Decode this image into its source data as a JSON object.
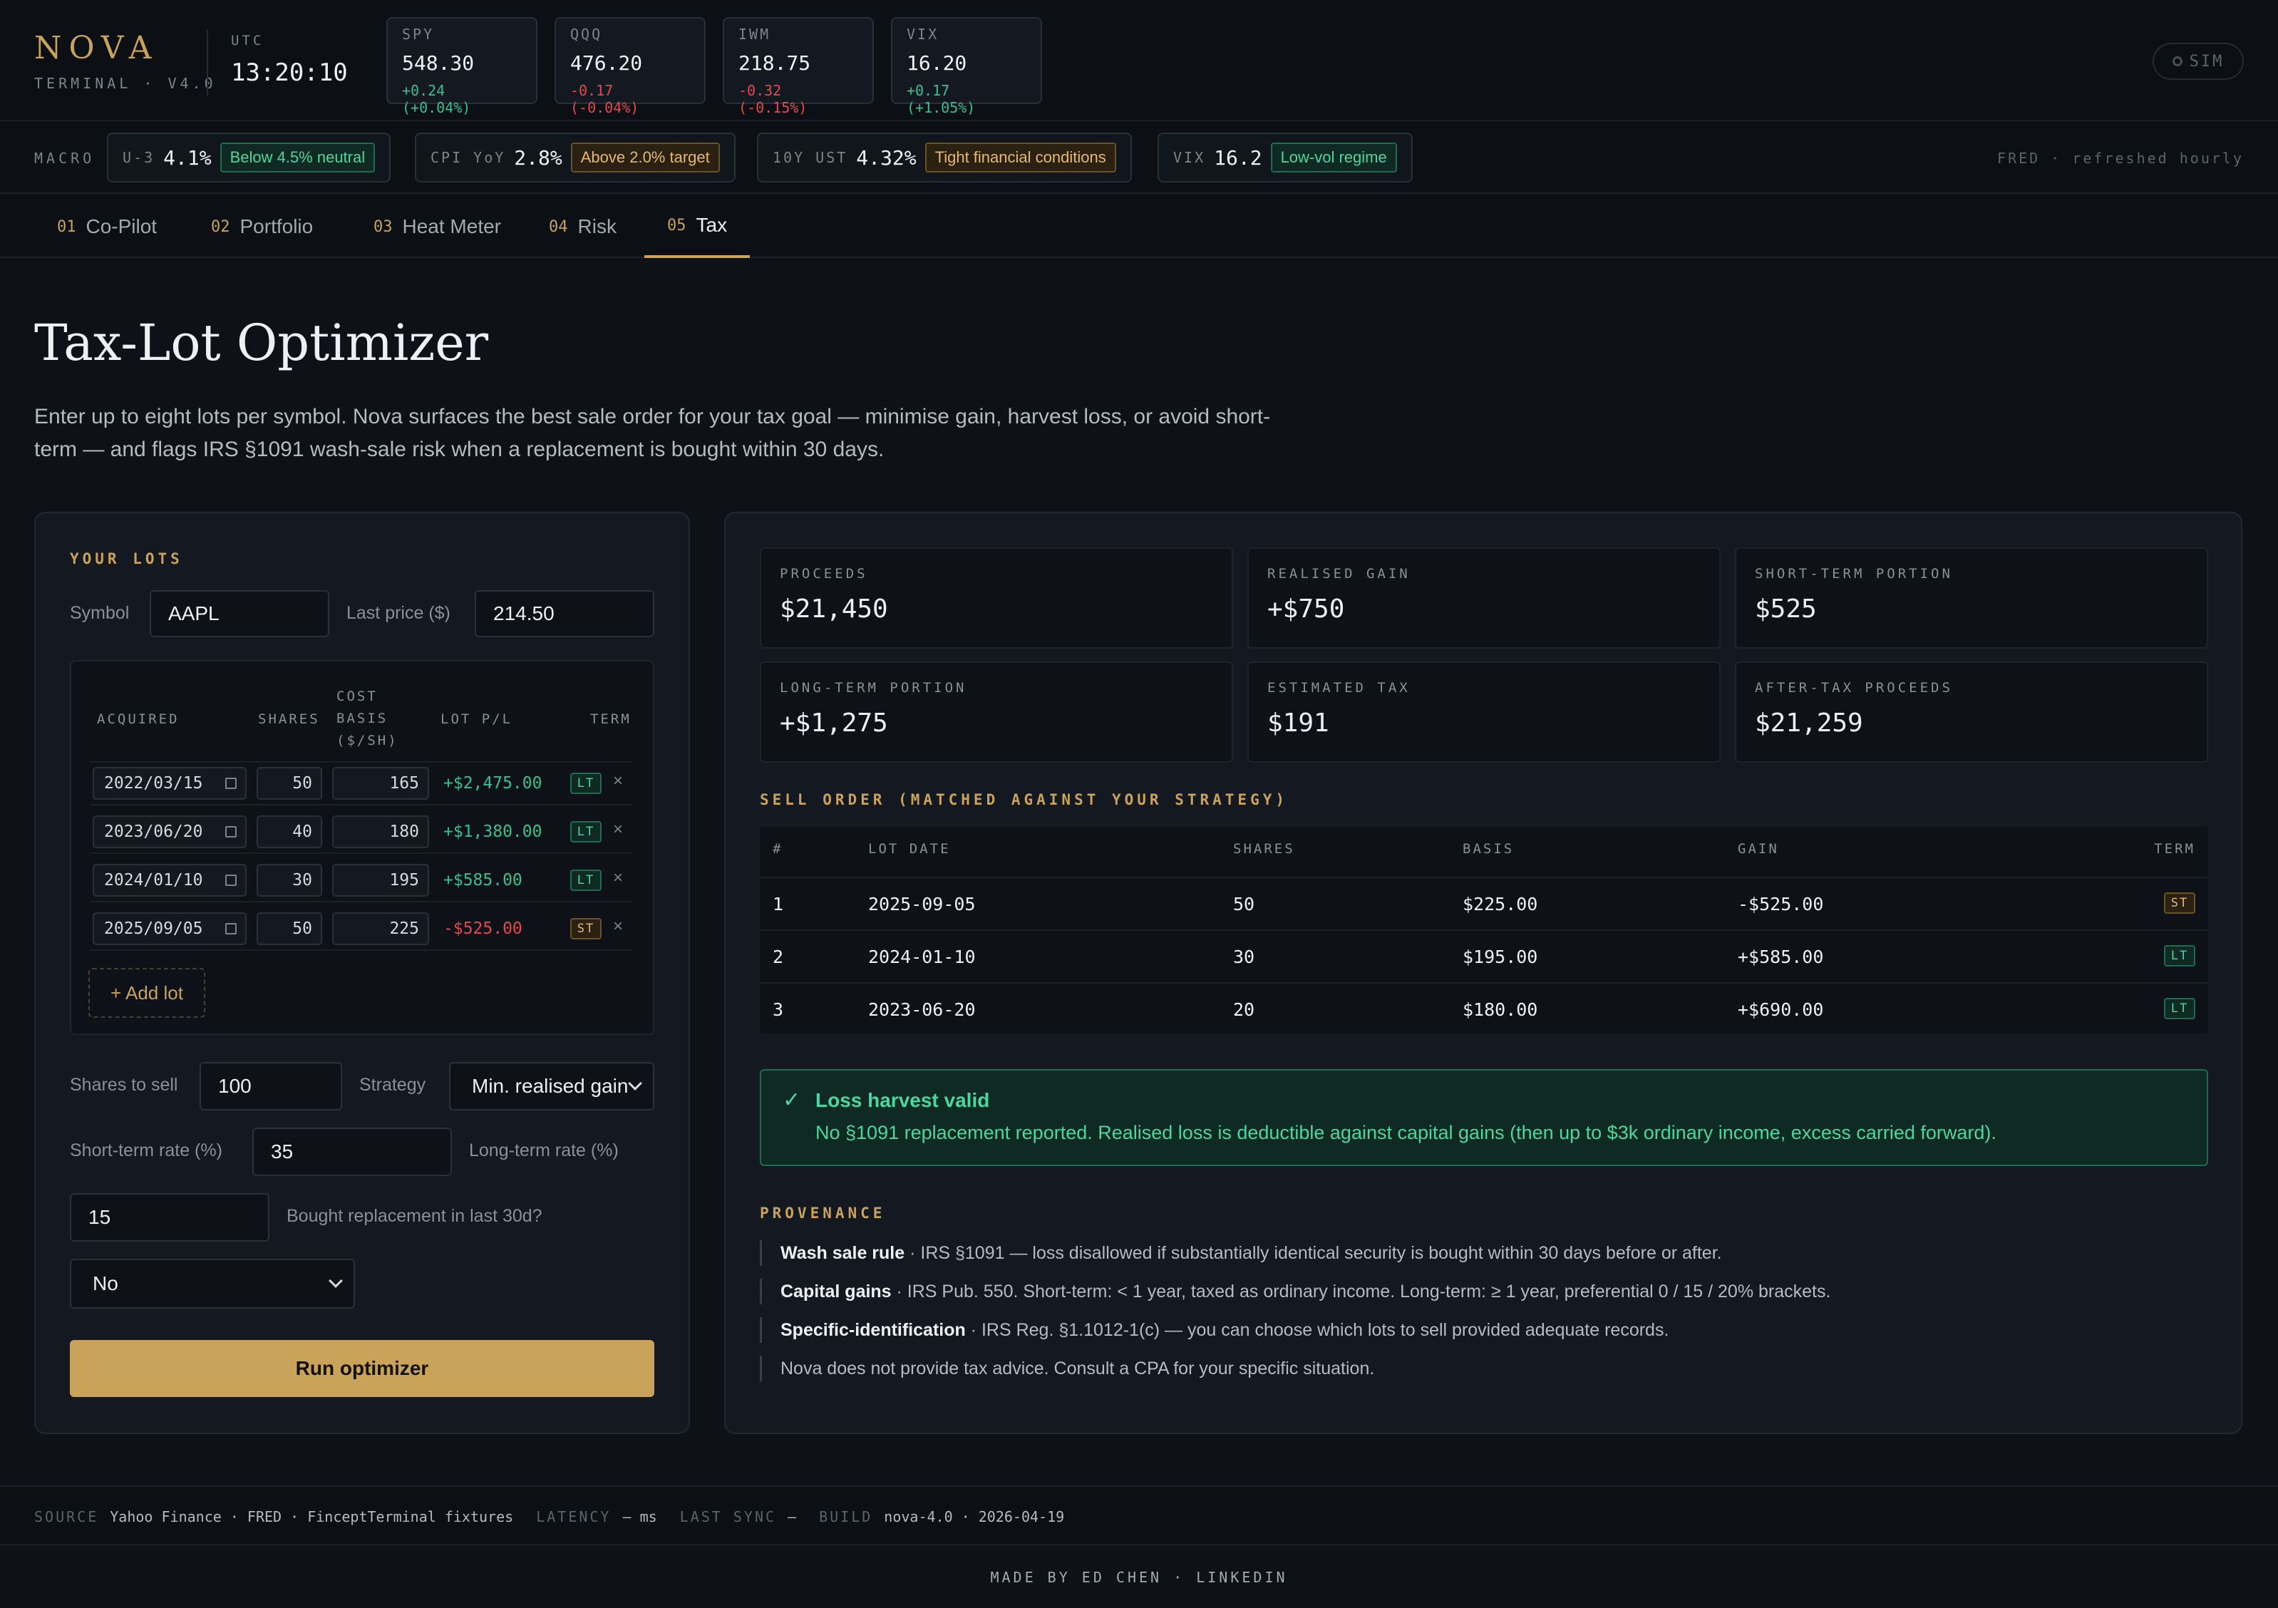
{
  "brand": {
    "name": "NOVA",
    "sub": "TERMINAL · V4.0"
  },
  "clock": {
    "label": "UTC",
    "time": "13:20:10"
  },
  "tickers": [
    {
      "sym": "SPY",
      "price": "548.30",
      "change": "+0.24 (+0.04%)",
      "dir": "up"
    },
    {
      "sym": "QQQ",
      "price": "476.20",
      "change": "-0.17 (-0.04%)",
      "dir": "down"
    },
    {
      "sym": "IWM",
      "price": "218.75",
      "change": "-0.32 (-0.15%)",
      "dir": "down"
    },
    {
      "sym": "VIX",
      "price": "16.20",
      "change": "+0.17 (+1.05%)",
      "dir": "up"
    }
  ],
  "sim_label": "SIM",
  "macro": {
    "label": "MACRO",
    "items": [
      {
        "key": "U-3",
        "value": "4.1%",
        "note": "Below 4.5% neutral",
        "tone": "green"
      },
      {
        "key": "CPI YoY",
        "value": "2.8%",
        "note": "Above 2.0% target",
        "tone": "amber"
      },
      {
        "key": "10Y UST",
        "value": "4.32%",
        "note": "Tight financial conditions",
        "tone": "amber"
      },
      {
        "key": "VIX",
        "value": "16.2",
        "note": "Low-vol regime",
        "tone": "green"
      }
    ],
    "source_note": "FRED · refreshed hourly"
  },
  "tabs": [
    {
      "num": "01",
      "label": "Co-Pilot"
    },
    {
      "num": "02",
      "label": "Portfolio"
    },
    {
      "num": "03",
      "label": "Heat Meter"
    },
    {
      "num": "04",
      "label": "Risk"
    },
    {
      "num": "05",
      "label": "Tax",
      "active": true
    }
  ],
  "page": {
    "title": "Tax-Lot Optimizer",
    "lead": "Enter up to eight lots per symbol. Nova surfaces the best sale order for your tax goal — minimise gain, harvest loss, or avoid short-term — and flags IRS §1091 wash-sale risk when a replacement is bought within 30 days."
  },
  "lots_panel": {
    "section": "YOUR LOTS",
    "symbol_label": "Symbol",
    "symbol_value": "AAPL",
    "price_label": "Last price ($)",
    "price_value": "214.50",
    "headers": {
      "acquired": "ACQUIRED",
      "shares": "SHARES",
      "cost_1": "COST",
      "cost_2": "BASIS",
      "cost_3": "($/SH)",
      "pl": "LOT P/L",
      "term": "TERM"
    },
    "lots": [
      {
        "date": "2022/03/15",
        "shares": "50",
        "cost": "165",
        "pl": "+$2,475.00",
        "pl_dir": "up",
        "term": "LT"
      },
      {
        "date": "2023/06/20",
        "shares": "40",
        "cost": "180",
        "pl": "+$1,380.00",
        "pl_dir": "up",
        "term": "LT"
      },
      {
        "date": "2024/01/10",
        "shares": "30",
        "cost": "195",
        "pl": "+$585.00",
        "pl_dir": "up",
        "term": "LT"
      },
      {
        "date": "2025/09/05",
        "shares": "50",
        "cost": "225",
        "pl": "-$525.00",
        "pl_dir": "down",
        "term": "ST"
      }
    ],
    "remove_glyph": "×",
    "add_lot": "+ Add lot",
    "shares_to_sell_label": "Shares to sell",
    "shares_to_sell_value": "100",
    "strategy_label": "Strategy",
    "strategy_value": "Min. realised gain",
    "st_rate_label": "Short-term rate (%)",
    "st_rate_value": "35",
    "lt_rate_label": "Long-term rate (%)",
    "lt_rate_value": "15",
    "replacement_label": "Bought replacement in last 30d?",
    "replacement_value": "No",
    "run_button": "Run optimizer"
  },
  "results": {
    "stats": [
      {
        "key": "PROCEEDS",
        "value": "$21,450",
        "tone": "plain"
      },
      {
        "key": "REALISED GAIN",
        "value": "+$750",
        "tone": "up"
      },
      {
        "key": "SHORT-TERM PORTION",
        "value": "$525",
        "tone": "plain"
      },
      {
        "key": "LONG-TERM PORTION",
        "value": "+$1,275",
        "tone": "plain"
      },
      {
        "key": "ESTIMATED TAX",
        "value": "$191",
        "tone": "down"
      },
      {
        "key": "AFTER-TAX PROCEEDS",
        "value": "$21,259",
        "tone": "up"
      }
    ],
    "order_section": "SELL ORDER (MATCHED AGAINST YOUR STRATEGY)",
    "order_headers": {
      "num": "#",
      "date": "LOT DATE",
      "shares": "SHARES",
      "basis": "BASIS",
      "gain": "GAIN",
      "term": "TERM"
    },
    "order_rows": [
      {
        "num": "1",
        "date": "2025-09-05",
        "shares": "50",
        "basis": "$225.00",
        "gain": "-$525.00",
        "dir": "down",
        "term": "ST"
      },
      {
        "num": "2",
        "date": "2024-01-10",
        "shares": "30",
        "basis": "$195.00",
        "gain": "+$585.00",
        "dir": "up",
        "term": "LT"
      },
      {
        "num": "3",
        "date": "2023-06-20",
        "shares": "20",
        "basis": "$180.00",
        "gain": "+$690.00",
        "dir": "up",
        "term": "LT"
      }
    ],
    "alert": {
      "icon": "✓",
      "title": "Loss harvest valid",
      "body": "No §1091 replacement reported. Realised loss is deductible against capital gains (then up to $3k ordinary income, excess carried forward)."
    },
    "provenance_section": "PROVENANCE",
    "provenance": [
      {
        "bold": "Wash sale rule",
        "text": " · IRS §1091 — loss disallowed if substantially identical security is bought within 30 days before or after."
      },
      {
        "bold": "Capital gains",
        "text": " · IRS Pub. 550. Short-term: < 1 year, taxed as ordinary income. Long-term: ≥ 1 year, preferential 0 / 15 / 20% brackets."
      },
      {
        "bold": "Specific-identification",
        "text": " · IRS Reg. §1.1012-1(c) — you can choose which lots to sell provided adequate records."
      },
      {
        "bold": "",
        "text": "Nova does not provide tax advice. Consult a CPA for your specific situation."
      }
    ]
  },
  "footer": {
    "source_k": "SOURCE",
    "source_v": "Yahoo Finance · FRED · FinceptTerminal fixtures",
    "latency_k": "LATENCY",
    "latency_v": "— ms",
    "sync_k": "LAST SYNC",
    "sync_v": "—",
    "build_k": "BUILD",
    "build_v": "nova-4.0 · 2026-04-19",
    "credit": "MADE BY ED CHEN · LINKEDIN"
  },
  "colors": {
    "accent": "#c9a35a",
    "positive": "#34c38f",
    "negative": "#e5484d",
    "background": "#0e1117"
  }
}
